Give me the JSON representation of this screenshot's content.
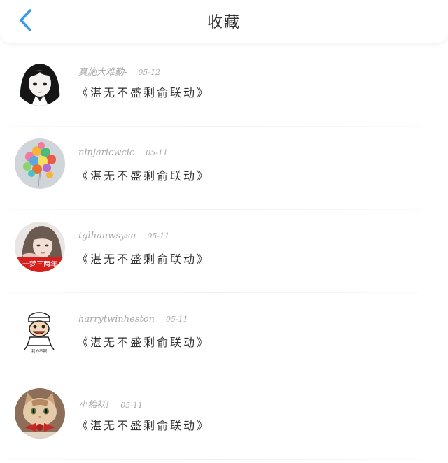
{
  "header": {
    "title": "收藏",
    "back_icon": "chevron-left-icon",
    "accent_color": "#3a9be8"
  },
  "favorites": [
    {
      "username": "真施大难勤-",
      "date": "05-12",
      "post": "《湛无不盛剩俞联动》"
    },
    {
      "username": "ninjaricwcic",
      "date": "05-11",
      "post": "《湛无不盛剩俞联动》"
    },
    {
      "username": "tglhauwsysn",
      "date": "05-11",
      "post": "《湛无不盛剩俞联动》"
    },
    {
      "username": "harrytwinheston",
      "date": "05-11",
      "post": "《湛无不盛剩俞联动》"
    },
    {
      "username": "小棉袄!",
      "date": "05-11",
      "post": "《湛无不盛剩俞联动》"
    }
  ],
  "avatars": [
    {
      "subject": "anime-girl-black-hair"
    },
    {
      "subject": "colorful-balloons"
    },
    {
      "subject": "woman-portrait",
      "banner_text": "一梦三两年"
    },
    {
      "subject": "cartoon-chef-character",
      "caption": "我的不服"
    },
    {
      "subject": "kitten-with-bowtie"
    }
  ]
}
